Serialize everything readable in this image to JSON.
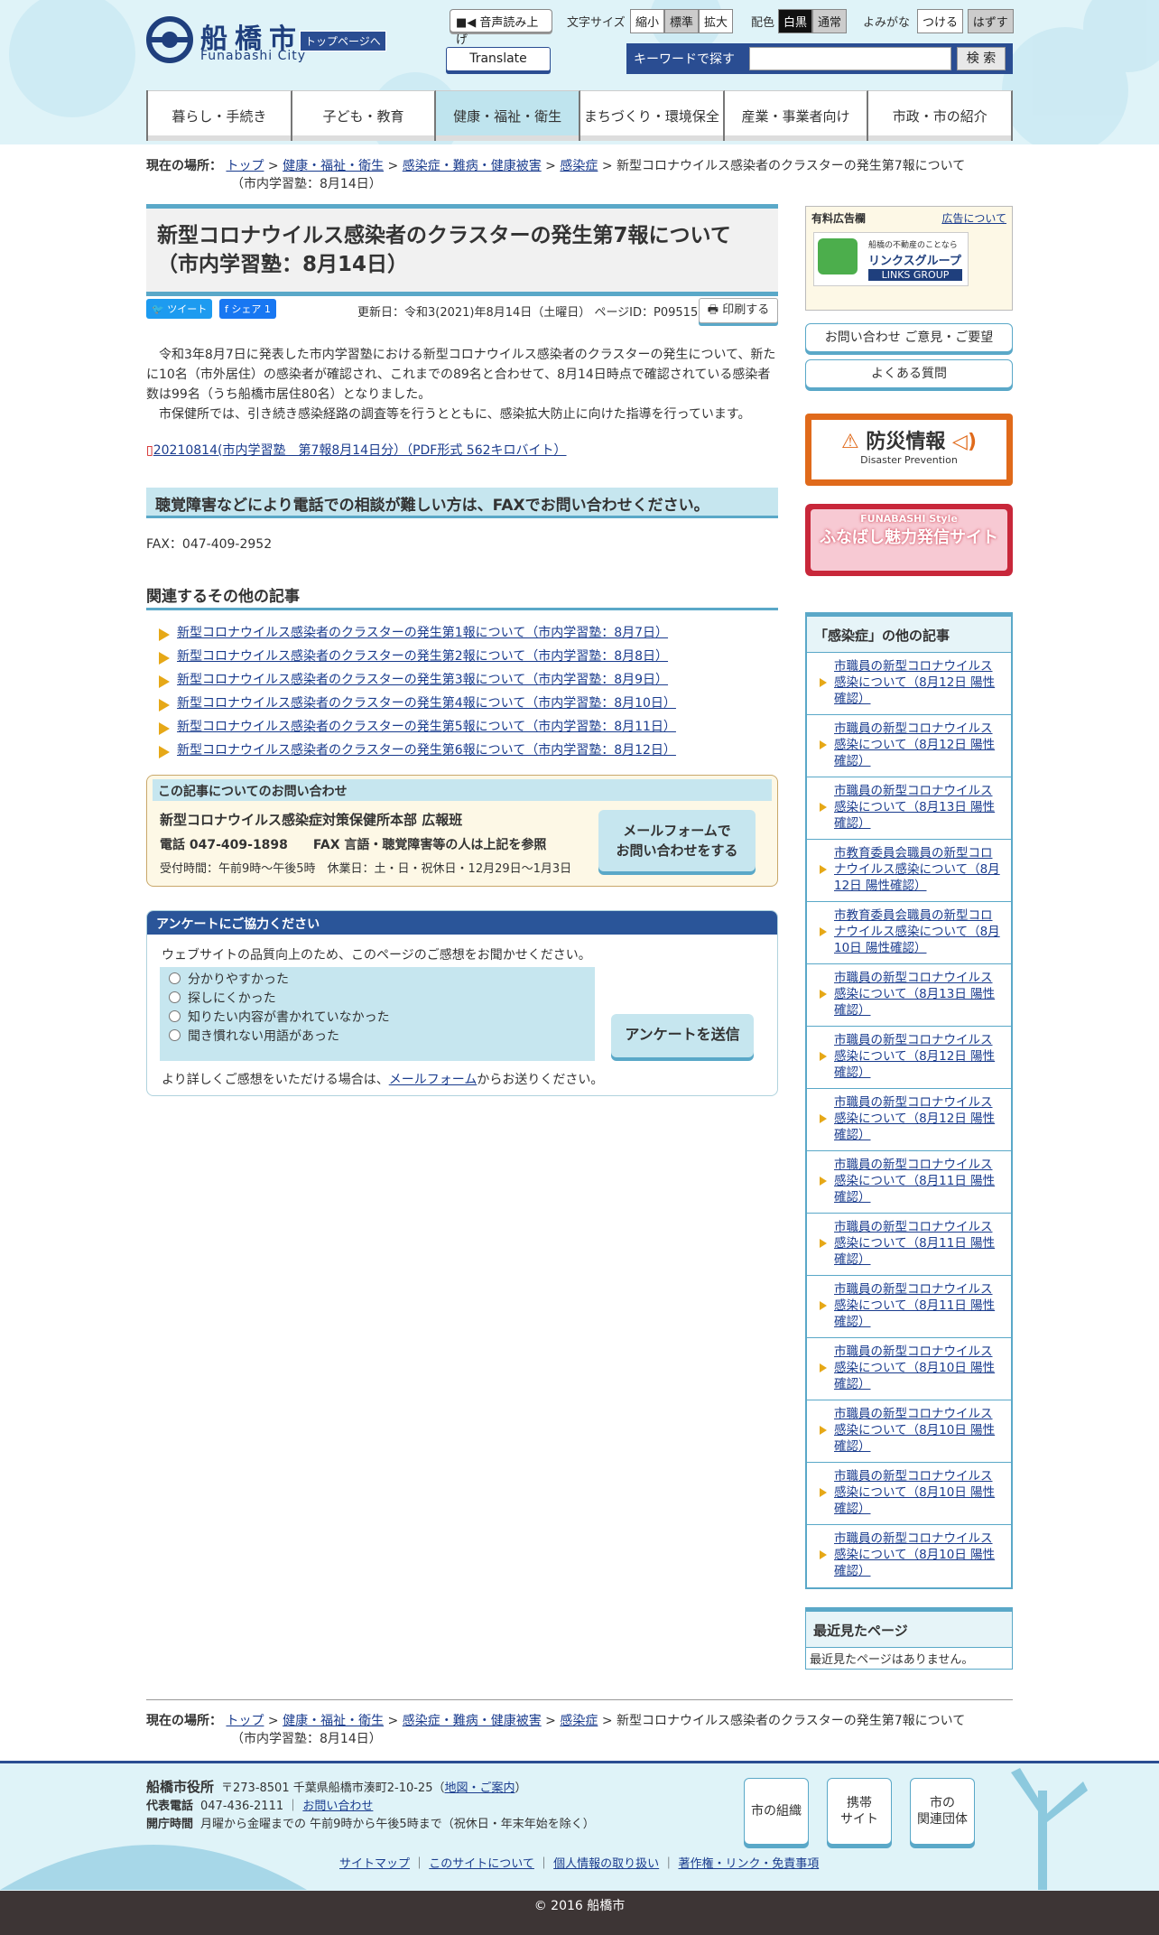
{
  "header": {
    "city_jp": "船橋市",
    "city_en": "Funabashi City",
    "top_link": "トップページへ",
    "voice": "音声読み上げ",
    "font_label": "文字サイズ",
    "font_opts": [
      "縮小",
      "標準",
      "拡大"
    ],
    "color_label": "配色",
    "color_opts": [
      "白黒",
      "通常"
    ],
    "ruby_label": "よみがな",
    "ruby_opts": [
      "つける",
      "はずす"
    ],
    "translate": "Translate",
    "search_label": "キーワードで探す",
    "search_btn": "検 索"
  },
  "nav": [
    "暮らし・手続き",
    "子ども・教育",
    "健康・福祉・衛生",
    "まちづくり・環境保全",
    "産業・事業者向け",
    "市政・市の紹介"
  ],
  "breadcrumb": {
    "label": "現在の場所：",
    "items": [
      "トップ",
      "健康・福祉・衛生",
      "感染症・難病・健康被害",
      "感染症"
    ],
    "current1": "新型コロナウイルス感染者のクラスターの発生第7報について",
    "current2": "（市内学習塾：8月14日）"
  },
  "article": {
    "title1": "新型コロナウイルス感染者のクラスターの発生第7報について",
    "title2": "（市内学習塾：8月14日）",
    "tweet": "ツイート",
    "share": "シェア 1",
    "updated": "更新日：令和3(2021)年8月14日（土曜日） ページID：P095157",
    "print": "印刷する",
    "p1": "令和3年8月7日に発表した市内学習塾における新型コロナウイルス感染者のクラスターの発生について、新たに10名（市外居住）の感染者が確認され、これまでの89名と合わせて、8月14日時点で確認されている感染者数は99名（うち船橋市居住80名）となりました。",
    "p2": "市保健所では、引き続き感染経路の調査等を行うとともに、感染拡大防止に向けた指導を行っています。",
    "pdf": "20210814(市内学習塾　第7報8月14日分）（PDF形式 562キロバイト）",
    "h2": "聴覚障害などにより電話での相談が難しい方は、FAXでお問い合わせください。",
    "fax": "FAX：047-409-2952",
    "related_h": "関連するその他の記事",
    "related": [
      "新型コロナウイルス感染者のクラスターの発生第1報について（市内学習塾：8月7日）",
      "新型コロナウイルス感染者のクラスターの発生第2報について（市内学習塾：8月8日）",
      "新型コロナウイルス感染者のクラスターの発生第3報について（市内学習塾：8月9日）",
      "新型コロナウイルス感染者のクラスターの発生第4報について（市内学習塾：8月10日）",
      "新型コロナウイルス感染者のクラスターの発生第5報について（市内学習塾：8月11日）",
      "新型コロナウイルス感染者のクラスターの発生第6報について（市内学習塾：8月12日）"
    ]
  },
  "contact": {
    "h": "この記事についてのお問い合わせ",
    "dept": "新型コロナウイルス感染症対策保健所本部 広報班",
    "tel": "電話 047-409-1898　　FAX 言語・聴覚障害等の人は上記を参照",
    "hours": "受付時間：午前9時～午後5時　休業日：土・日・祝休日・12月29日～1月3日",
    "mail1": "メールフォームで",
    "mail2": "お問い合わせをする"
  },
  "survey": {
    "h": "アンケートにご協力ください",
    "intro": "ウェブサイトの品質向上のため、このページのご感想をお聞かせください。",
    "opts": [
      "分かりやすかった",
      "探しにくかった",
      "知りたい内容が書かれていなかった",
      "聞き慣れない用語があった"
    ],
    "submit": "アンケートを送信",
    "more_pre": "より詳しくご感想をいただける場合は、",
    "more_link": "メールフォーム",
    "more_post": "からお送りください。"
  },
  "side": {
    "ad_title": "有料広告欄",
    "ad_link": "広告について",
    "ad_text1": "船橋の不動産のことなら",
    "ad_text2": "リンクスグループ",
    "ad_text3": "LINKS GROUP",
    "contact_btn": "お問い合わせ ご意見・ご要望",
    "faq_btn": "よくある質問",
    "bousai1": "防災情報",
    "bousai2": "Disaster Prevention",
    "funa1": "FUNABASHI Style",
    "funa2": "ふなばし魅力発信サイト",
    "others_h": "「感染症」の他の記事",
    "others": [
      "市職員の新型コロナウイルス感染について（8月12日 陽性確認）",
      "市職員の新型コロナウイルス感染について（8月12日 陽性確認）",
      "市職員の新型コロナウイルス感染について（8月13日 陽性確認）",
      "市教育委員会職員の新型コロナウイルス感染について（8月12日 陽性確認）",
      "市教育委員会職員の新型コロナウイルス感染について（8月10日 陽性確認）",
      "市職員の新型コロナウイルス感染について（8月13日 陽性確認）",
      "市職員の新型コロナウイルス感染について（8月12日 陽性確認）",
      "市職員の新型コロナウイルス感染について（8月12日 陽性確認）",
      "市職員の新型コロナウイルス感染について（8月11日 陽性確認）",
      "市職員の新型コロナウイルス感染について（8月11日 陽性確認）",
      "市職員の新型コロナウイルス感染について（8月11日 陽性確認）",
      "市職員の新型コロナウイルス感染について（8月10日 陽性確認）",
      "市職員の新型コロナウイルス感染について（8月10日 陽性確認）",
      "市職員の新型コロナウイルス感染について（8月10日 陽性確認）",
      "市職員の新型コロナウイルス感染について（8月10日 陽性確認）"
    ],
    "recent_h": "最近見たページ",
    "recent_b": "最近見たページはありません。"
  },
  "footer": {
    "name": "船橋市役所",
    "addr": "〒273-8501 千葉県船橋市湊町2-10-25（",
    "map": "地図・ご案内",
    "addr_end": "）",
    "tel_l": "代表電話",
    "tel": "047-436-2111 ｜",
    "contact": "お問い合わせ",
    "hours_l": "開庁時間",
    "hours": "月曜から金曜までの 午前9時から午後5時まで（祝休日・年末年始を除く）",
    "btn1": "市の組織",
    "btn2a": "携帯",
    "btn2b": "サイト",
    "btn3a": "市の",
    "btn3b": "関連団体",
    "links": [
      "サイトマップ",
      "このサイトについて",
      "個人情報の取り扱い",
      "著作権・リンク・免責事項"
    ],
    "copyright": "© 2016 船橋市"
  }
}
